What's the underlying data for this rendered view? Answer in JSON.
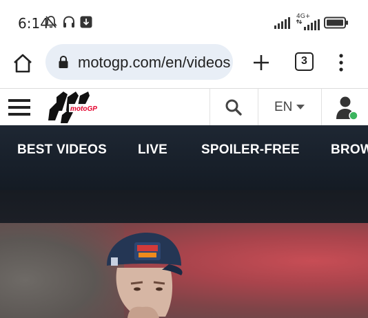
{
  "status_bar": {
    "time": "6:14",
    "icons_left": [
      "bell-off-icon",
      "headphones-icon",
      "download-icon"
    ],
    "icons_right": [
      "signal-icon",
      "network-4g-icon",
      "battery-icon"
    ],
    "network_label": "4G+"
  },
  "browser": {
    "url": "motogp.com/en/videos",
    "tab_count": "3"
  },
  "site_header": {
    "logo_text": "motoGP",
    "language": "EN"
  },
  "nav": {
    "items": [
      "BEST VIDEOS",
      "LIVE",
      "SPOILER-FREE",
      "BROWSE"
    ]
  },
  "colors": {
    "accent_red": "#e4002b",
    "nav_bg": "#1a222c",
    "url_bar_bg": "#e8eef6",
    "online_green": "#3cb55e"
  }
}
